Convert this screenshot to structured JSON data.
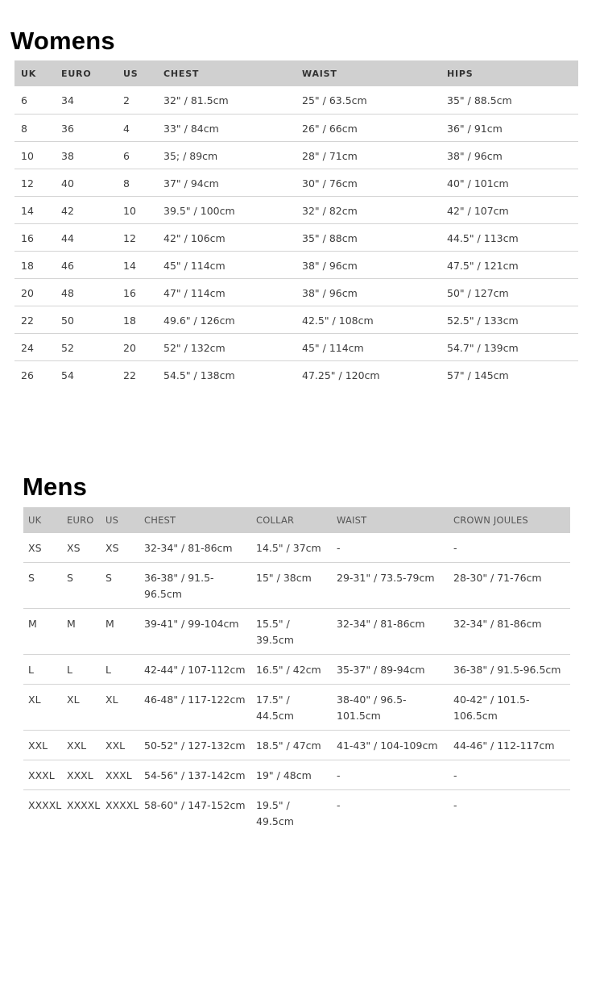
{
  "womens": {
    "title": "Womens",
    "headers": [
      "UK",
      "EURO",
      "US",
      "CHEST",
      "WAIST",
      "HIPS"
    ],
    "rows": [
      [
        "6",
        "34",
        "2",
        "32\" / 81.5cm",
        "25\" / 63.5cm",
        "35\" / 88.5cm"
      ],
      [
        "8",
        "36",
        "4",
        "33\" / 84cm",
        "26\" / 66cm",
        "36\" / 91cm"
      ],
      [
        "10",
        "38",
        "6",
        "35; / 89cm",
        "28\" / 71cm",
        "38\" / 96cm"
      ],
      [
        "12",
        "40",
        "8",
        "37\" / 94cm",
        "30\" / 76cm",
        "40\" / 101cm"
      ],
      [
        "14",
        "42",
        "10",
        "39.5\" / 100cm",
        "32\" / 82cm",
        "42\" / 107cm"
      ],
      [
        "16",
        "44",
        "12",
        "42\" / 106cm",
        "35\" / 88cm",
        "44.5\" / 113cm"
      ],
      [
        "18",
        "46",
        "14",
        "45\" / 114cm",
        "38\" / 96cm",
        "47.5\" / 121cm"
      ],
      [
        "20",
        "48",
        "16",
        "47\" / 114cm",
        "38\" / 96cm",
        "50\" / 127cm"
      ],
      [
        "22",
        "50",
        "18",
        "49.6\" / 126cm",
        "42.5\" / 108cm",
        "52.5\" / 133cm"
      ],
      [
        "24",
        "52",
        "20",
        "52\" / 132cm",
        "45\" / 114cm",
        "54.7\" / 139cm"
      ],
      [
        "26",
        "54",
        "22",
        "54.5\" / 138cm",
        "47.25\" / 120cm",
        "57\" / 145cm"
      ]
    ]
  },
  "mens": {
    "title": "Mens",
    "headers": [
      "UK",
      "EURO",
      "US",
      "CHEST",
      "COLLAR",
      "WAIST",
      "CROWN JOULES"
    ],
    "rows": [
      [
        "XS",
        "XS",
        "XS",
        "32-34\" / 81-86cm",
        "14.5\" / 37cm",
        "-",
        "-"
      ],
      [
        "S",
        "S",
        "S",
        "36-38\" / 91.5-96.5cm",
        "15\" / 38cm",
        "29-31\" / 73.5-79cm",
        "28-30\" / 71-76cm"
      ],
      [
        "M",
        "M",
        "M",
        "39-41\" / 99-104cm",
        "15.5\" / 39.5cm",
        "32-34\" / 81-86cm",
        "32-34\" / 81-86cm"
      ],
      [
        "L",
        "L",
        "L",
        "42-44\" / 107-112cm",
        "16.5\" / 42cm",
        "35-37\" / 89-94cm",
        "36-38\" / 91.5-96.5cm"
      ],
      [
        "XL",
        "XL",
        "XL",
        "46-48\" / 117-122cm",
        "17.5\" / 44.5cm",
        "38-40\" / 96.5-101.5cm",
        "40-42\" / 101.5-106.5cm"
      ],
      [
        "XXL",
        "XXL",
        "XXL",
        "50-52\" / 127-132cm",
        "18.5\" / 47cm",
        "41-43\" / 104-109cm",
        "44-46\" / 112-117cm"
      ],
      [
        "XXXL",
        "XXXL",
        "XXXL",
        "54-56\" / 137-142cm",
        "19\" / 48cm",
        "-",
        "-"
      ],
      [
        "XXXXL",
        "XXXXL",
        "XXXXL",
        "58-60\" / 147-152cm",
        "19.5\" / 49.5cm",
        "-",
        "-"
      ]
    ]
  }
}
